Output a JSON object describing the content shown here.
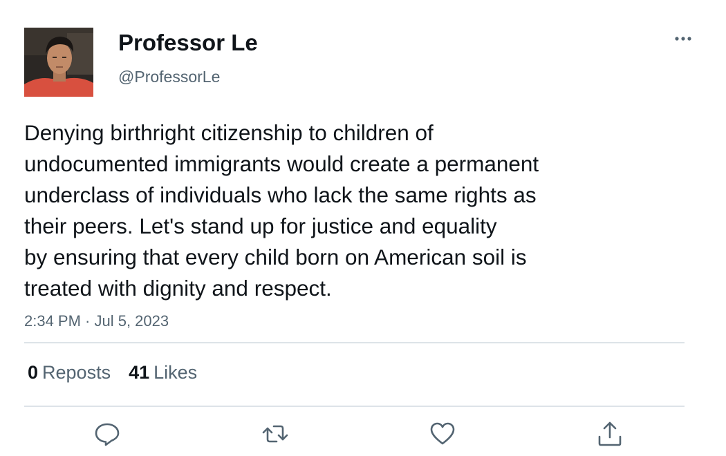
{
  "author": {
    "display_name": "Professor Le",
    "handle": "@ProfessorLe"
  },
  "tweet": {
    "text": "Denying birthright citizenship to children of\nundocumented immigrants would create a permanent\nunderclass of individuals who lack the same rights as\ntheir peers. Let's stand up for justice and equality\nby ensuring that every child born on American soil is\ntreated with dignity and respect.",
    "timestamp": "2:34 PM · Jul 5, 2023"
  },
  "stats": {
    "reposts_count": "0",
    "reposts_label": "Reposts",
    "likes_count": "41",
    "likes_label": "Likes"
  },
  "icons": {
    "more": "more-horizontal-icon",
    "reply": "reply-bubble-icon",
    "repost": "repost-arrows-icon",
    "like": "heart-icon",
    "share": "share-upload-icon"
  },
  "colors": {
    "text_primary": "#0f1419",
    "text_secondary": "#536471",
    "icon_gray": "#536471",
    "divider": "#dde3e8"
  }
}
